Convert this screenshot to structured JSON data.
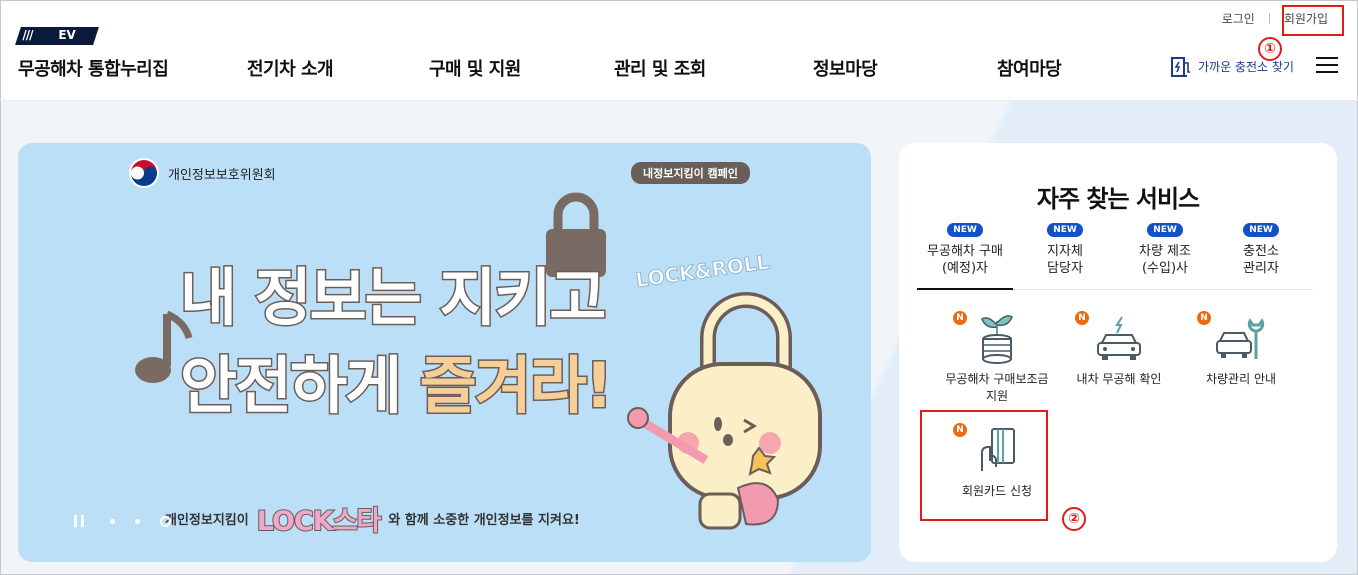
{
  "header": {
    "util": {
      "login": "로그인",
      "signup": "회원가입"
    },
    "logo_slashes": "///",
    "logo_ev": "EV",
    "site_name": "무공해차 통합누리집",
    "nav": [
      "전기차 소개",
      "구매 및 지원",
      "관리 및 조회",
      "정보마당",
      "참여마당"
    ],
    "charger_link": "가까운 충전소 찾기"
  },
  "banner": {
    "org": "개인정보보호위원회",
    "campaign_tag": "내정보지킴이 캠페인",
    "hero_line1_a": "내 정보는 ",
    "hero_line1_b": "지키고",
    "hero_line2_a": "안전하게 ",
    "hero_line2_b": "즐겨라!",
    "bottom_prefix": "개인정보지킴이",
    "bottom_star": "LOCK스타",
    "bottom_suffix": "와 함께 소중한 개인정보를 지켜요!",
    "illus_text": "LOCK&ROLL"
  },
  "panel": {
    "title": "자주 찾는 서비스",
    "tabs": [
      {
        "badge": "NEW",
        "line1": "무공해차 구매",
        "line2": "(예정)자"
      },
      {
        "badge": "NEW",
        "line1": "지자체",
        "line2": "담당자"
      },
      {
        "badge": "NEW",
        "line1": "차량 제조",
        "line2": "(수입)사"
      },
      {
        "badge": "NEW",
        "line1": "충전소",
        "line2": "관리자"
      }
    ],
    "services": [
      {
        "n": "N",
        "line1": "무공해차 구매보조금",
        "line2": "지원"
      },
      {
        "n": "N",
        "line1": "내차 무공해 확인",
        "line2": ""
      },
      {
        "n": "N",
        "line1": "차량관리 안내",
        "line2": ""
      },
      {
        "n": "N",
        "line1": "회원카드 신청",
        "line2": ""
      }
    ]
  },
  "annotations": [
    "①",
    "②"
  ],
  "colors": {
    "accent": "#1251c9",
    "banner_bg": "#bcdff8",
    "annotation": "#e21b1b",
    "new_badge_n": "#ea6a10"
  }
}
